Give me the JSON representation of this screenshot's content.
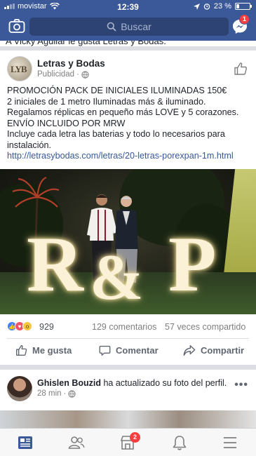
{
  "status_bar": {
    "carrier": "movistar",
    "time": "12:39",
    "battery": "23 %",
    "battery_level": 0.23
  },
  "header": {
    "search_placeholder": "Buscar",
    "messenger_badge": "1"
  },
  "previous_item": {
    "text": "A Vicky Aguilar le gusta Letras y Bodas."
  },
  "post": {
    "author": "Letras y Bodas",
    "meta_label": "Publicidad",
    "meta_separator": "·",
    "lines": [
      "PROMOCIÓN PACK DE INICIALES ILUMINADAS 150€",
      "2 iniciales de 1 metro Iluminadas más & iluminado.",
      "Regalamos réplicas en pequeño más LOVE y 5 corazones.",
      "ENVÍO INCLUIDO POR MRW",
      "Incluye cada letra las baterias y todo lo necesarios para",
      "instalación."
    ],
    "link": "http://letrasybodas.com/letras/20-letras-porexpan-1m.html",
    "photo_letters": {
      "left": "R",
      "middle": "&",
      "right": "P"
    },
    "reactions_count": "929",
    "comments": "129 comentarios",
    "shares": "57 veces compartido",
    "actions": {
      "like": "Me gusta",
      "comment": "Comentar",
      "share": "Compartir"
    }
  },
  "next_post": {
    "author": "Ghislen Bouzid",
    "action": " ha actualizado su foto del perfil.",
    "time": "28 min",
    "meta_separator": "·"
  },
  "tab_bar": {
    "notifications_badge": "2"
  },
  "colors": {
    "brand": "#3b5998",
    "badge": "#fa3e3e",
    "link": "#365899"
  },
  "icons": [
    "camera-icon",
    "search-icon",
    "messenger-icon",
    "globe-icon",
    "like-outline-icon",
    "comment-icon",
    "share-icon",
    "more-icon",
    "news-feed-icon",
    "friends-icon",
    "marketplace-icon",
    "bell-icon",
    "menu-icon"
  ]
}
